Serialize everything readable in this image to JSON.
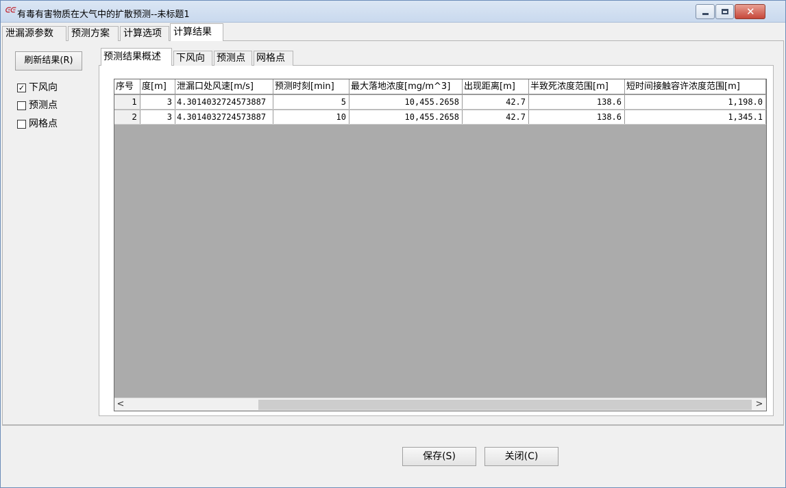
{
  "window": {
    "title": "有毒有害物质在大气中的扩散预测--未标题1",
    "app_icon": "ᕮᕮ"
  },
  "outer_tabs": [
    {
      "label": "泄漏源参数",
      "active": false
    },
    {
      "label": "预测方案",
      "active": false
    },
    {
      "label": "计算选项",
      "active": false
    },
    {
      "label": "计算结果",
      "active": true
    }
  ],
  "left": {
    "refresh_button": "刷新结果(R)",
    "checkboxes": [
      {
        "label": "下风向",
        "checked": true
      },
      {
        "label": "预测点",
        "checked": false
      },
      {
        "label": "网格点",
        "checked": false
      }
    ]
  },
  "inner_tabs": [
    {
      "label": "预测结果概述",
      "active": true
    },
    {
      "label": "下风向",
      "active": false
    },
    {
      "label": "预测点",
      "active": false
    },
    {
      "label": "网格点",
      "active": false
    }
  ],
  "grid": {
    "headers": [
      "序号",
      "度[m]",
      "泄漏口处风速[m/s]",
      "预测时刻[min]",
      "最大落地浓度[mg/m^3]",
      "出现距离[m]",
      "半致死浓度范围[m]",
      "短时间接触容许浓度范围[m]"
    ],
    "rows": [
      [
        "1",
        "3",
        "4.3014032724573887",
        "5",
        "10,455.2658",
        "42.7",
        "138.6",
        "1,198.0"
      ],
      [
        "2",
        "3",
        "4.3014032724573887",
        "10",
        "10,455.2658",
        "42.7",
        "138.6",
        "1,345.1"
      ]
    ],
    "scroll_left": "<",
    "scroll_right": ">"
  },
  "buttons": {
    "save": "保存(S)",
    "close": "关闭(C)"
  },
  "icons": {
    "check": "✓",
    "close_glyph": "✕"
  }
}
